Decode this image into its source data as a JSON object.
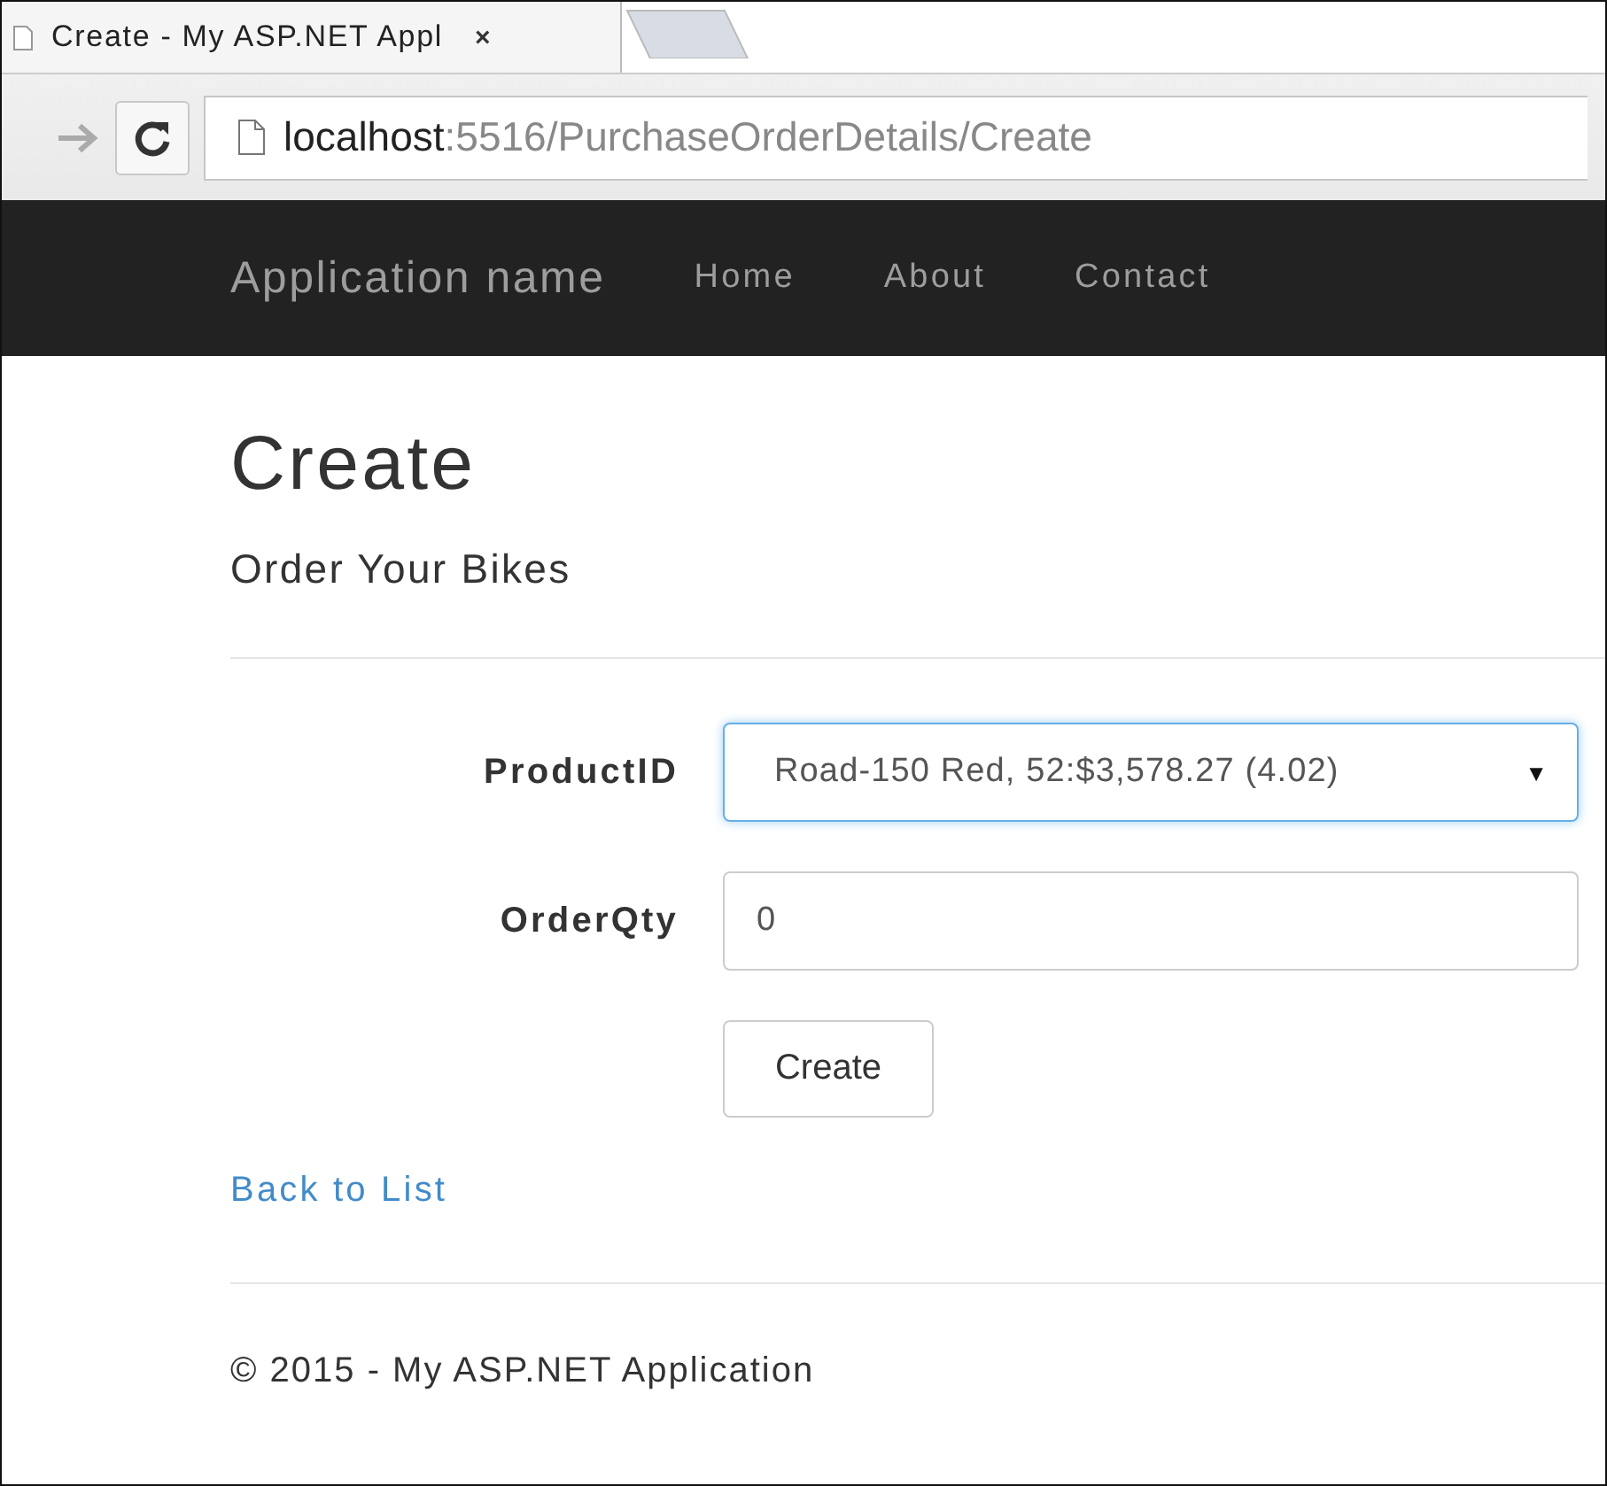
{
  "browser": {
    "tab": {
      "title": "Create - My ASP.NET Appl",
      "close": "×"
    },
    "url": {
      "host": "localhost",
      "path": ":5516/PurchaseOrderDetails/Create"
    }
  },
  "navbar": {
    "brand": "Application name",
    "links": [
      "Home",
      "About",
      "Contact"
    ]
  },
  "heading": "Create",
  "subheading": "Order Your Bikes",
  "form": {
    "fields": [
      {
        "kind": "select",
        "label": "ProductID",
        "value": "Road-150 Red, 52:$3,578.27 (4.02)",
        "caret": "▼",
        "focused": true
      },
      {
        "kind": "input",
        "label": "OrderQty",
        "value": "0",
        "focused": false
      }
    ],
    "submit": "Create"
  },
  "back_link": "Back to List",
  "footer": "© 2015 - My ASP.NET Application"
}
